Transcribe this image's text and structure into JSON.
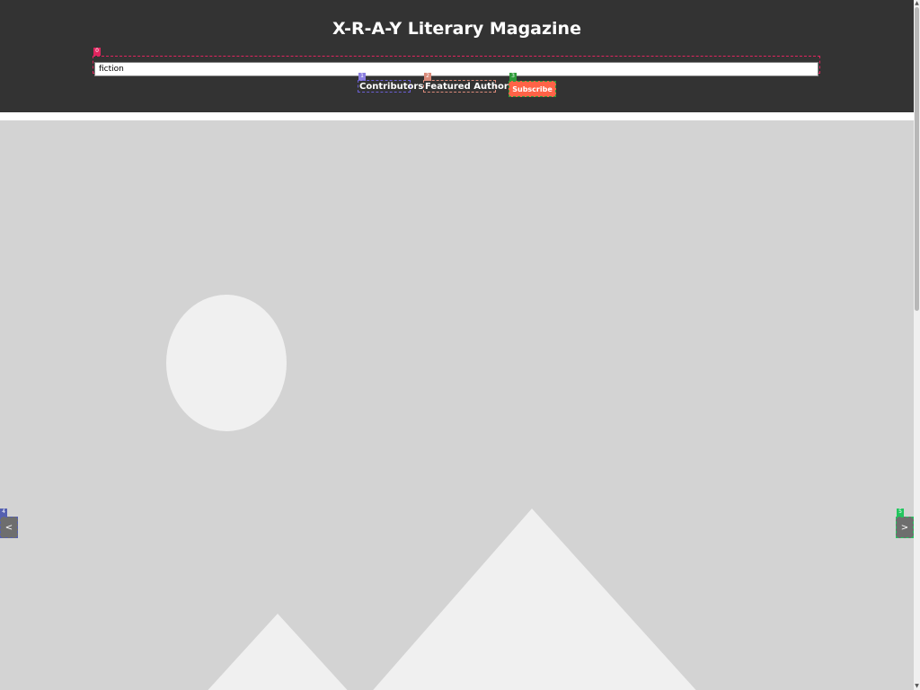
{
  "header": {
    "title": "X-R-A-Y Literary Magazine",
    "search": {
      "value": "fiction",
      "placeholder": ""
    },
    "nav": {
      "contributors": "Contributors",
      "featured_authors": "Featured Authors"
    },
    "subscribe_label": "Subscribe"
  },
  "carousel": {
    "prev_label": "<",
    "next_label": ">",
    "image_icon": "image-placeholder-icon"
  },
  "tags": {
    "search": "0",
    "contributors": "1",
    "featured": "2",
    "subscribe": "3",
    "prev": "4",
    "next": "5"
  },
  "colors": {
    "header_bg": "#333333",
    "subscribe_bg": "#ff6347",
    "carousel_bg": "#d3d3d3",
    "placeholder_shape": "#f0f0f0"
  },
  "scrollbar": {
    "up_icon": "scroll-up-arrow-icon",
    "down_icon": "scroll-down-arrow-icon"
  }
}
